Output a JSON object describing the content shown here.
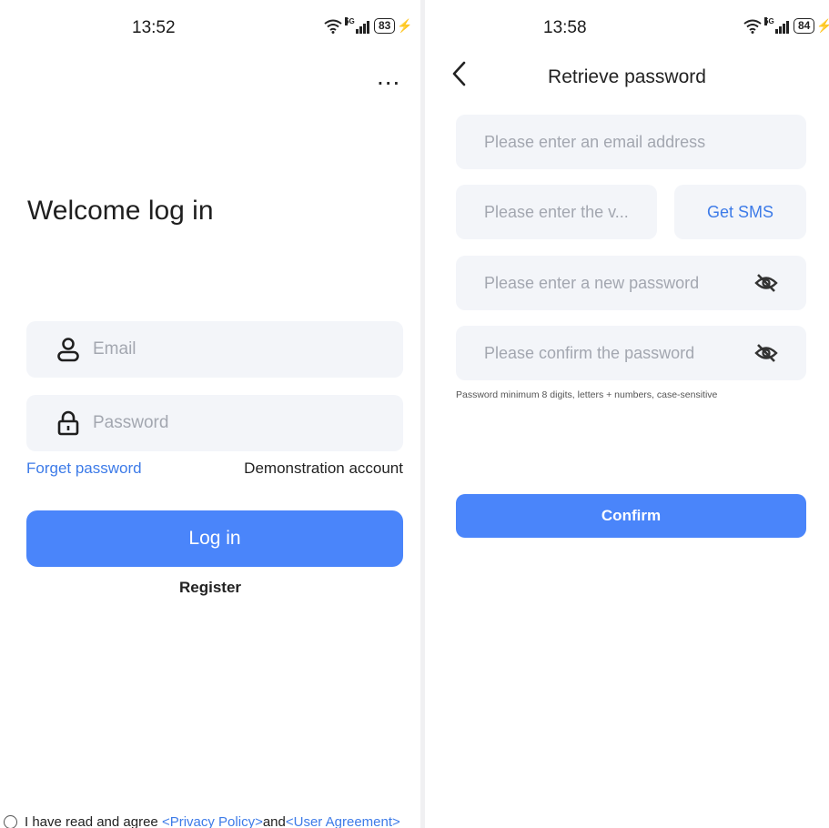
{
  "login_screen": {
    "status_bar": {
      "time": "13:52",
      "network": "5G",
      "battery": "83"
    },
    "more_menu": "...",
    "heading": "Welcome log in",
    "email_placeholder": "Email",
    "password_placeholder": "Password",
    "forget_password": "Forget password",
    "demo_account": "Demonstration account",
    "login_button": "Log in",
    "register": "Register",
    "agreement": {
      "prefix": "I have read and agree ",
      "privacy": "<Privacy Policy>",
      "and": "and",
      "user": "<User Agreement>"
    }
  },
  "retrieve_screen": {
    "status_bar": {
      "time": "13:58",
      "network": "5G",
      "battery": "84"
    },
    "title": "Retrieve password",
    "email_placeholder": "Please enter an email address",
    "code_placeholder": "Please enter the v...",
    "get_sms": "Get SMS",
    "new_password_placeholder": "Please enter a new password",
    "confirm_password_placeholder": "Please confirm the password",
    "hint": "Password minimum 8 digits, letters + numbers, case-sensitive",
    "confirm_button": "Confirm"
  },
  "icons": [
    "wifi-icon",
    "signal-icon",
    "battery-icon",
    "charging-icon",
    "more-icon",
    "user-icon",
    "lock-icon",
    "radio-icon",
    "back-arrow-icon",
    "eye-off-icon"
  ],
  "colors": {
    "accent": "#4a85fa",
    "link": "#3d7be8",
    "field_bg": "#f3f5f9"
  }
}
